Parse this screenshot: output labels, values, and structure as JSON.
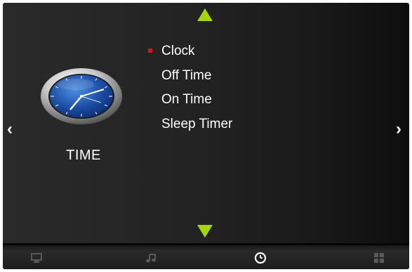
{
  "category": {
    "label": "TIME",
    "icon": "clock-icon"
  },
  "menu": {
    "selected_index": 0,
    "items": [
      {
        "label": "Clock"
      },
      {
        "label": "Off Time"
      },
      {
        "label": "On Time"
      },
      {
        "label": "Sleep Timer"
      }
    ]
  },
  "navigation": {
    "left_glyph": "‹",
    "right_glyph": "›",
    "up_icon": "up-arrow-icon",
    "down_icon": "down-arrow-icon"
  },
  "tabs": [
    {
      "icon": "picture-monitor-icon",
      "active": false
    },
    {
      "icon": "music-note-icon",
      "active": false
    },
    {
      "icon": "clock-icon",
      "active": true
    },
    {
      "icon": "grid-setup-icon",
      "active": false
    }
  ],
  "colors": {
    "accent_arrow": "#a8d400",
    "selection_bullet": "#e01010",
    "text": "#ffffff",
    "inactive_tab_icon": "#5a5a5a",
    "active_tab_icon": "#ffffff"
  }
}
